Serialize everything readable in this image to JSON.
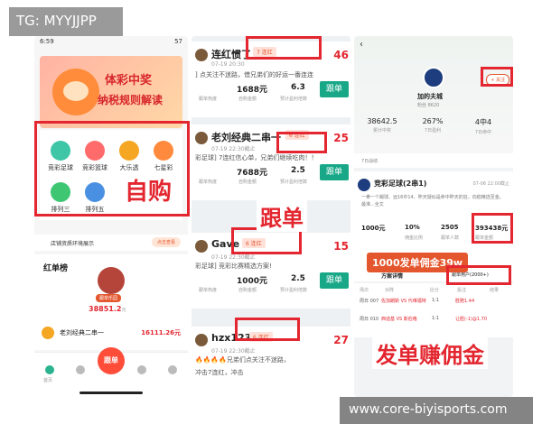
{
  "watermark": {
    "top_left": "TG: MYYJJPP",
    "bottom_right": "www.core-biyisports.com"
  },
  "phone1": {
    "status_time": "6:59",
    "status_right": "57",
    "banner": {
      "line1": "体彩中奖",
      "line2": "纳税规则解读"
    },
    "sports": [
      {
        "label": "竞彩足球",
        "color": "#3ec6a7"
      },
      {
        "label": "竞彩篮球",
        "color": "#ff6b6b"
      },
      {
        "label": "大乐透",
        "color": "#f5a623"
      },
      {
        "label": "七星彩",
        "color": "#ff8a3d"
      },
      {
        "label": "排列三",
        "color": "#3ec673"
      },
      {
        "label": "排列五",
        "color": "#4a90e2"
      }
    ],
    "big_label": "自购",
    "notice": {
      "text": "店铺资质环境展示",
      "button": "点击查看"
    },
    "rank": {
      "title": "红单榜",
      "badge": "跟单乐园",
      "amount": "38851.2",
      "unit": "元"
    },
    "ranker": {
      "name": "老刘经典二串一",
      "amount": "16111.26",
      "unit": "元"
    },
    "tabbar": {
      "items": [
        "首页",
        "",
        "跟单",
        "",
        ""
      ],
      "fab": "跟单"
    }
  },
  "phone2": {
    "big_label": "跟单",
    "cards": [
      {
        "name": "连红惯了",
        "streak": "7 连红",
        "time": "07-19 20:30",
        "rednum": "46",
        "desc": "] 点关注不迷路，借兄弟们的好运一番连连",
        "v1": "1688元",
        "v2": "6.3",
        "labels": [
          "跟单热度",
          "自购金额",
          "预计盈利倍数"
        ],
        "follow": "跟单"
      },
      {
        "name": "老刘经典二串一",
        "streak": "6 连红",
        "time": "07-19 22:30截止",
        "rednum": "25",
        "desc": "彩足球] 7连红信心单，兄弟们继续吃肉！！",
        "v1": "7688元",
        "v2": "2.5",
        "labels": [
          "跟单热度",
          "自购金额",
          "预计盈利倍数"
        ],
        "follow": "跟单"
      },
      {
        "name": "Gave",
        "streak": "6 连红",
        "time": "07-19 22:30截止",
        "rednum": "15",
        "desc": "彩足球] 竞彩比赛精选方案!",
        "v1": "1000元",
        "v2": "2.5",
        "labels": [
          "跟单热度",
          "自购金额",
          "预计盈利倍数"
        ],
        "follow": "跟单"
      },
      {
        "name": "hzx123",
        "streak": "6 连红",
        "time": "07-19 22:30截止",
        "rednum": "27",
        "desc": "🔥🔥🔥🔥兄弟们点关注不迷路，",
        "v1": "",
        "v2": "",
        "labels": [
          "",
          "",
          ""
        ],
        "follow": ""
      }
    ],
    "tail": "冲击7连红，冲击"
  },
  "phone3": {
    "club": "加的夫城",
    "fans": "粉丝 8620",
    "follow_btn": "+ 关注",
    "stats": [
      {
        "value": "38642.5",
        "label": "累计中奖"
      },
      {
        "value": "267%",
        "label": "7日盈利"
      },
      {
        "value": "4中4",
        "label": "7日命中"
      }
    ],
    "week": "7日战绩",
    "post": {
      "title": "竞彩足球(2串1)",
      "date": "07-06 22:00截止",
      "body": "一拳一个踢球、远16中14、昨天疑似是命中昨天的狂，向稳精选至金。最准...全文",
      "vals": [
        "1000元",
        "10%",
        "2505",
        "393438元"
      ],
      "labels": [
        "",
        "佣金比例",
        "跟单人数",
        "跟单金额"
      ]
    },
    "promo": "1000发单佣金39w",
    "scheme": {
      "tab": "方案详情",
      "users": "跟单用户(2000+)"
    },
    "table_head": [
      "场次",
      "对阵",
      "比分",
      "投注",
      "结果"
    ],
    "table_rows": [
      [
        "周日 007",
        "佐加朗斯 VS 代维福特",
        "1:1",
        "胜赔1.44"
      ],
      [
        "周日 010",
        "西迪基 VS 斯伯格",
        "1:1",
        "让胜(-1)@1.70"
      ]
    ],
    "big_label": "发单赚佣金"
  }
}
